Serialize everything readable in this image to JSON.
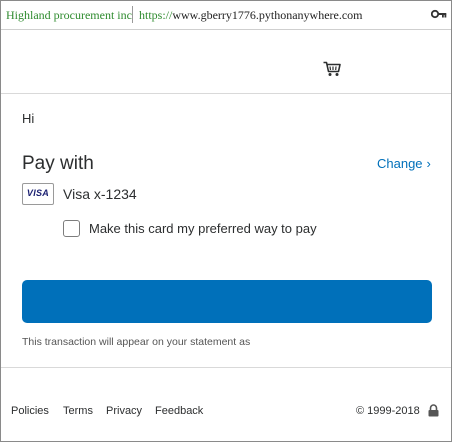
{
  "browser": {
    "organization": "Highland procurement inc",
    "url_scheme": "https://",
    "url_rest": "www.gberry1776.pythonanywhere.com",
    "icon": "key-icon"
  },
  "header": {
    "cart_icon": "cart-icon"
  },
  "main": {
    "greeting": "Hi",
    "pay_with_heading": "Pay with",
    "change_link": "Change",
    "change_chevron": "›",
    "card_brand": "VISA",
    "card_label": "Visa x-1234",
    "preferred_checkbox_label": "Make this card my preferred way to pay",
    "preferred_checked": false,
    "pay_button_label": "",
    "statement_text": "This transaction will appear on your statement as"
  },
  "footer": {
    "links": [
      "Policies",
      "Terms",
      "Privacy",
      "Feedback"
    ],
    "copyright": "© 1999-2018",
    "lock_icon": "lock-icon"
  },
  "colors": {
    "accent": "#0070ba",
    "org_green": "#2e8b2e",
    "visa_blue": "#1a1f71",
    "text": "#2c2e2f"
  }
}
